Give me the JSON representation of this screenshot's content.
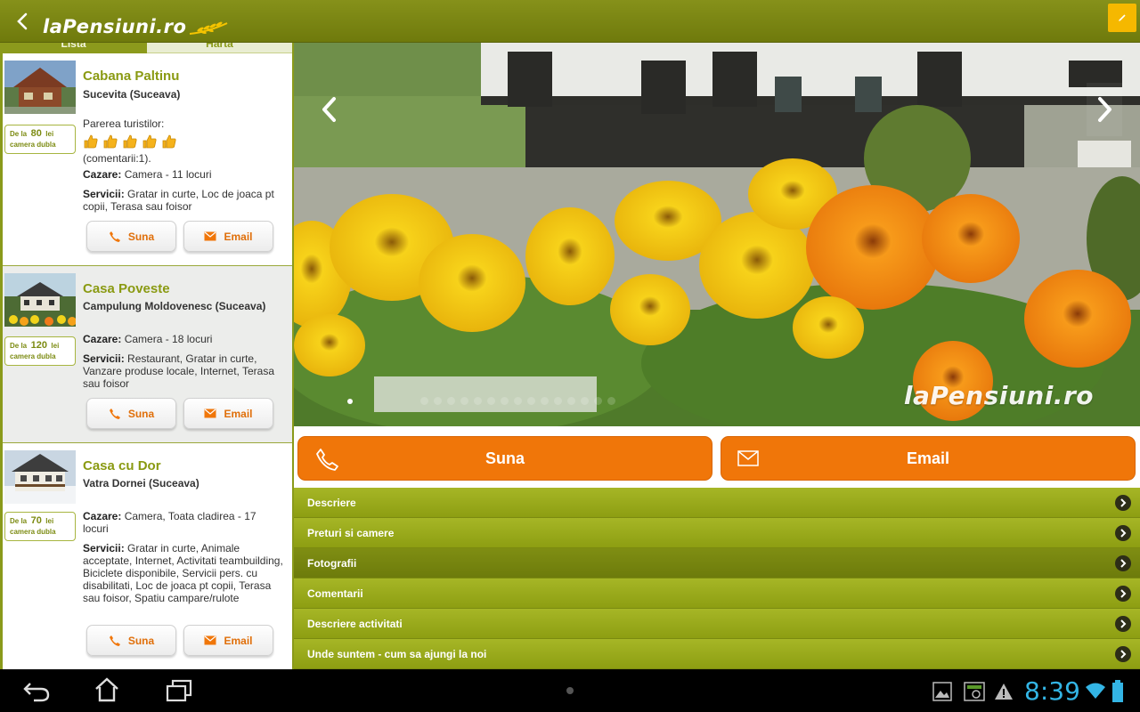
{
  "app": {
    "logo_text": "laPensiuni.ro",
    "menu_icon": "pencil-icon",
    "colors": {
      "brand_green": "#8a9a12",
      "accent_orange": "#f07609",
      "menu_yellow": "#f5b800"
    }
  },
  "tabs": [
    {
      "label": "Lista",
      "active": true
    },
    {
      "label": "Harta",
      "active": false
    }
  ],
  "listings": [
    {
      "name": "Cabana Paltinu",
      "location": "Sucevita (Suceava)",
      "price_prefix": "De la",
      "price": "80",
      "price_unit": "lei",
      "price_note": "camera dubla",
      "opinion_label": "Parerea turistilor:",
      "rating": 5,
      "comments": "(comentarii:1).",
      "cazare_label": "Cazare:",
      "cazare": "Camera - 11 locuri",
      "servicii_label": "Servicii:",
      "servicii": "Gratar in curte, Loc de joaca pt copii, Terasa sau foisor",
      "call_label": "Suna",
      "email_label": "Email"
    },
    {
      "name": "Casa Poveste",
      "location": "Campulung Moldovenesc (Suceava)",
      "price_prefix": "De la",
      "price": "120",
      "price_unit": "lei",
      "price_note": "camera dubla",
      "cazare_label": "Cazare:",
      "cazare": "Camera - 18 locuri",
      "servicii_label": "Servicii:",
      "servicii": "Restaurant, Gratar in curte, Vanzare produse locale, Internet, Terasa sau foisor",
      "call_label": "Suna",
      "email_label": "Email"
    },
    {
      "name": "Casa cu Dor",
      "location": "Vatra Dornei (Suceava)",
      "price_prefix": "De la",
      "price": "70",
      "price_unit": "lei",
      "price_note": "camera dubla",
      "cazare_label": "Cazare:",
      "cazare": "Camera, Toata cladirea - 17 locuri",
      "servicii_label": "Servicii:",
      "servicii": "Gratar in curte, Animale acceptate, Internet, Activitati teambuilding, Biciclete disponibile, Servicii pers. cu disabilitati, Loc de joaca pt copii, Terasa sau foisor, Spatiu campare/rulote",
      "call_label": "Suna",
      "email_label": "Email"
    }
  ],
  "gallery": {
    "watermark": "laPensiuni.ro",
    "photo_count": 16,
    "current_photo": 1
  },
  "detail_actions": {
    "call_label": "Suna",
    "email_label": "Email"
  },
  "sections": [
    {
      "label": "Descriere",
      "active": false
    },
    {
      "label": "Preturi si camere",
      "active": false
    },
    {
      "label": "Fotografii",
      "active": true
    },
    {
      "label": "Comentarii",
      "active": false
    },
    {
      "label": "Descriere activitati",
      "active": false
    },
    {
      "label": "Unde suntem - cum sa ajungi la noi",
      "active": false
    }
  ],
  "system": {
    "time": "8:39",
    "nav_icons": [
      "back-icon",
      "home-icon",
      "recent-apps-icon"
    ],
    "status_icons": [
      "gallery-icon",
      "screenshot-icon",
      "warning-icon",
      "wifi-icon",
      "battery-icon"
    ]
  }
}
